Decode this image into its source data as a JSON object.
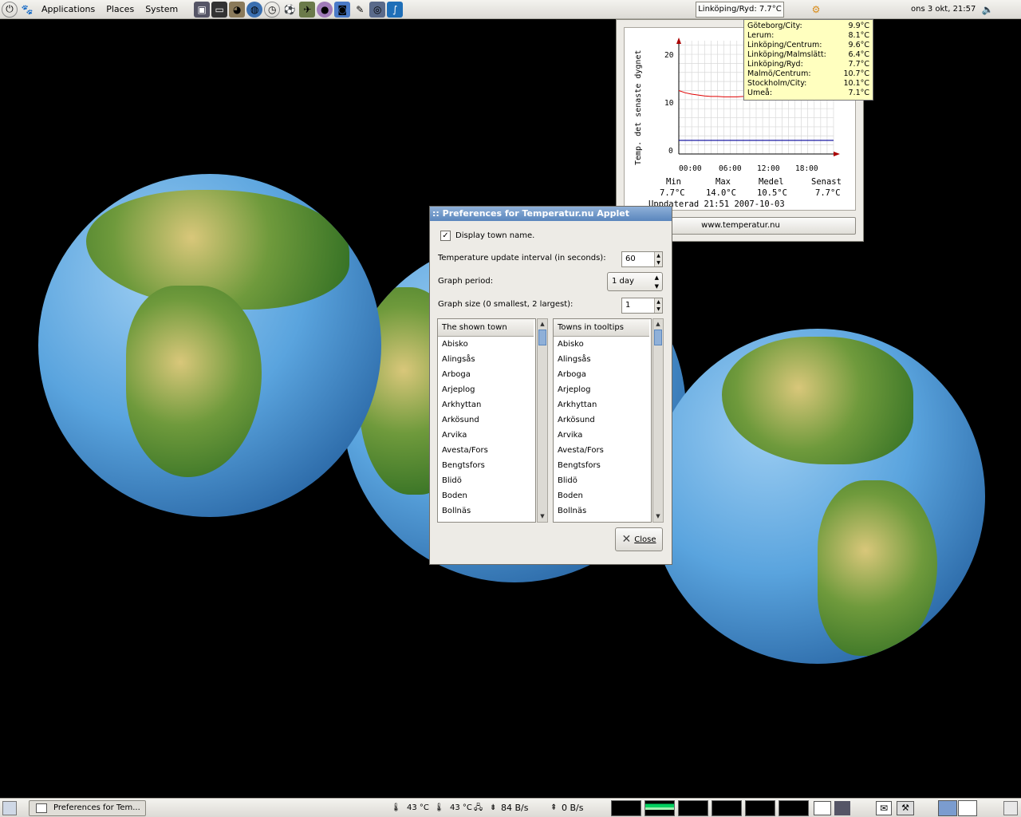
{
  "top_panel": {
    "menus": [
      "Applications",
      "Places",
      "System"
    ],
    "weather_applet": "Linköping/Ryd: 7.7°C",
    "clock": "ons  3 okt, 21:57"
  },
  "prefs": {
    "title": ":: Preferences for Temperatur.nu Applet",
    "display_town_label": "Display town name.",
    "display_town_checked": true,
    "interval_label": "Temperature update interval (in seconds):",
    "interval_value": "60",
    "period_label": "Graph period:",
    "period_value": "1 day",
    "size_label": "Graph size (0 smallest, 2 largest):",
    "size_value": "1",
    "shown_town_header": "The shown town",
    "tooltip_towns_header": "Towns in tooltips",
    "towns": [
      "Abisko",
      "Alingsås",
      "Arboga",
      "Arjeplog",
      "Arkhyttan",
      "Arkösund",
      "Arvika",
      "Avesta/Fors",
      "Bengtsfors",
      "Blidö",
      "Boden",
      "Bollnäs"
    ],
    "close_label": "Close"
  },
  "weather": {
    "ylabel": "Temp. det senaste dygnet",
    "yticks": [
      "20",
      "10",
      "0"
    ],
    "xticks": [
      "00:00",
      "06:00",
      "12:00",
      "18:00"
    ],
    "stats_headers": [
      "Min",
      "Max",
      "Medel",
      "Senast"
    ],
    "stats_values": [
      "7.7°C",
      "14.0°C",
      "10.5°C",
      "7.7°C"
    ],
    "updated": "Uppdaterad 21:51 2007-10-03",
    "website_label": "www.temperatur.nu",
    "colors": {
      "series": "#e00000",
      "zero_line": "#000099",
      "grid": "#d8d8d8"
    }
  },
  "chart_data": {
    "type": "line",
    "ylabel": "Temp. det senaste dygnet",
    "ylim": [
      -3,
      22
    ],
    "x": [
      0,
      1,
      2,
      3,
      4,
      5,
      6,
      7,
      8,
      9,
      10
    ],
    "series": [
      {
        "values": [
          11,
          10.5,
          10.2,
          10.0,
          9.8,
          9.7,
          9.7,
          9.6,
          9.6,
          9.6,
          9.7
        ]
      }
    ],
    "zero_line": 0
  },
  "tooltip": {
    "rows": [
      {
        "town": "Göteborg/City:",
        "temp": "9.9°C"
      },
      {
        "town": "Lerum:",
        "temp": "8.1°C"
      },
      {
        "town": "Linköping/Centrum:",
        "temp": "9.6°C"
      },
      {
        "town": "Linköping/Malmslätt:",
        "temp": "6.4°C"
      },
      {
        "town": "Linköping/Ryd:",
        "temp": "7.7°C"
      },
      {
        "town": "Malmö/Centrum:",
        "temp": "10.7°C"
      },
      {
        "town": "Stockholm/City:",
        "temp": "10.1°C"
      },
      {
        "town": "Umeå:",
        "temp": "7.1°C"
      }
    ]
  },
  "bottom_panel": {
    "task_label": "Preferences for Tem...",
    "temp1": "43 °C",
    "temp2": "43 °C",
    "net_down": "84 B/s",
    "net_up": "0 B/s"
  }
}
